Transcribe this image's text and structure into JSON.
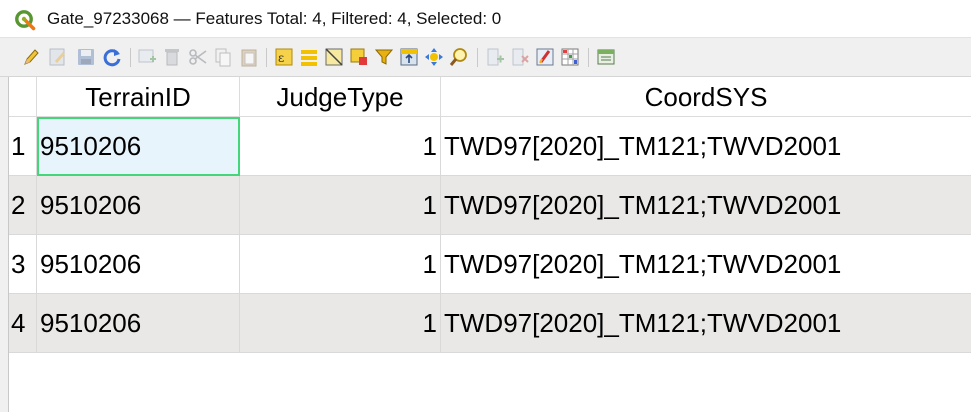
{
  "window": {
    "title": "Gate_97233068 — Features Total: 4, Filtered: 4, Selected: 0",
    "app_icon": "qgis-logo-icon",
    "accent_color": "#44d67a"
  },
  "toolbar": {
    "buttons": [
      {
        "icon": "pencil-edit-icon",
        "enabled": true
      },
      {
        "icon": "multi-edit-icon",
        "enabled": false
      },
      {
        "icon": "save-edits-icon",
        "enabled": false
      },
      {
        "icon": "reload-icon",
        "enabled": true
      },
      {
        "icon": "add-feature-icon",
        "enabled": false
      },
      {
        "icon": "delete-feature-icon",
        "enabled": false
      },
      {
        "icon": "cut-icon",
        "enabled": false
      },
      {
        "icon": "copy-icon",
        "enabled": false
      },
      {
        "icon": "paste-icon",
        "enabled": false
      },
      {
        "icon": "select-by-expression-icon",
        "enabled": true
      },
      {
        "icon": "select-all-icon",
        "enabled": true
      },
      {
        "icon": "invert-selection-icon",
        "enabled": true
      },
      {
        "icon": "deselect-all-icon",
        "enabled": true
      },
      {
        "icon": "filter-icon",
        "enabled": true
      },
      {
        "icon": "move-selection-to-top-icon",
        "enabled": true
      },
      {
        "icon": "pan-to-selection-icon",
        "enabled": true
      },
      {
        "icon": "zoom-to-selection-icon",
        "enabled": true
      },
      {
        "icon": "new-field-icon",
        "enabled": false
      },
      {
        "icon": "delete-field-icon",
        "enabled": false
      },
      {
        "icon": "field-calculator-icon",
        "enabled": true
      },
      {
        "icon": "conditional-formatting-icon",
        "enabled": true
      },
      {
        "icon": "dock-table-icon",
        "enabled": true
      }
    ]
  },
  "table": {
    "columns": [
      "TerrainID",
      "JudgeType",
      "CoordSYS"
    ],
    "rows": [
      {
        "num": "1",
        "TerrainID": "9510206",
        "JudgeType": "1",
        "CoordSYS": "TWD97[2020]_TM121;TWVD2001"
      },
      {
        "num": "2",
        "TerrainID": "9510206",
        "JudgeType": "1",
        "CoordSYS": "TWD97[2020]_TM121;TWVD2001"
      },
      {
        "num": "3",
        "TerrainID": "9510206",
        "JudgeType": "1",
        "CoordSYS": "TWD97[2020]_TM121;TWVD2001"
      },
      {
        "num": "4",
        "TerrainID": "9510206",
        "JudgeType": "1",
        "CoordSYS": "TWD97[2020]_TM121;TWVD2001"
      }
    ]
  }
}
